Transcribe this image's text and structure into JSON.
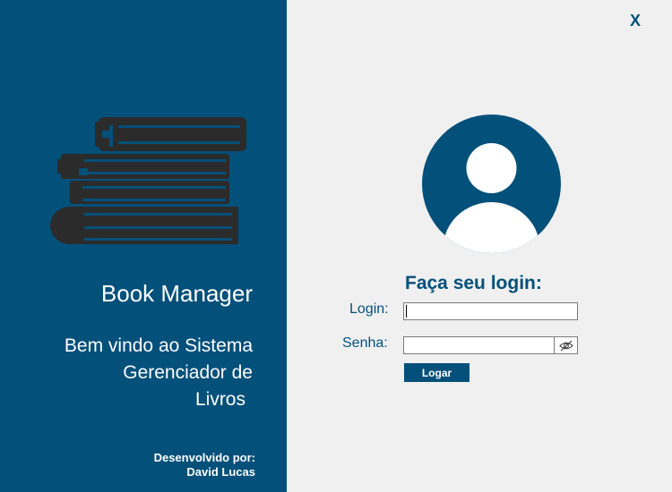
{
  "sidebar": {
    "app_title": "Book Manager",
    "welcome_lines": [
      "Bem vindo ao Sistema",
      "Gerenciador de",
      "Livros"
    ],
    "credits_label": "Desenvolvido por:",
    "credits_author": "David Lucas",
    "icon": "books-stack-icon"
  },
  "window": {
    "close_label": "X"
  },
  "login": {
    "avatar_icon": "user-avatar-icon",
    "heading": "Faça seu login:",
    "login_label": "Login:",
    "login_value": "",
    "password_label": "Senha:",
    "password_value": "",
    "toggle_icon": "eye-slash-icon",
    "submit_label": "Logar"
  },
  "colors": {
    "brand": "#03507a",
    "background": "#f0f0f0",
    "book_icon": "#2b2b2b"
  }
}
